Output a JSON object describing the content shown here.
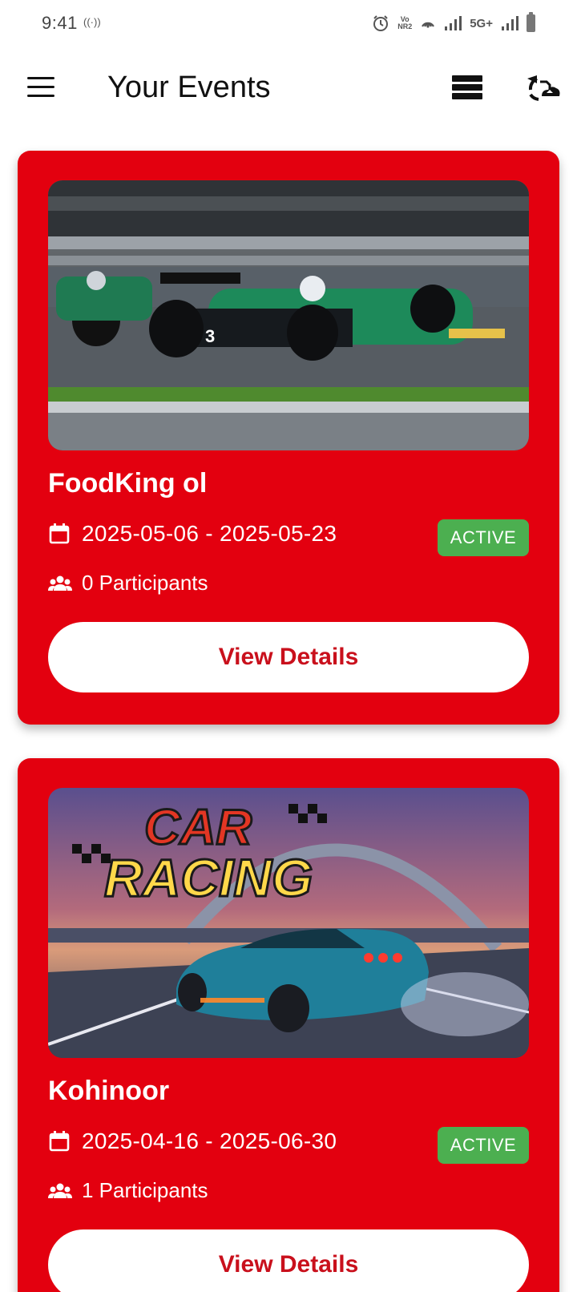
{
  "status_bar": {
    "time": "9:41",
    "hotspot": "((·))",
    "volte_top": "Vo",
    "volte_bottom": "NR2",
    "network": "5G+"
  },
  "app_bar": {
    "title": "Your Events"
  },
  "events": [
    {
      "title": "FoodKing ol",
      "date_range": "2025-05-06 - 2025-05-23",
      "status": "ACTIVE",
      "participants": "0 Participants",
      "button_label": "View Details"
    },
    {
      "title": "Kohinoor",
      "date_range": "2025-04-16 - 2025-06-30",
      "status": "ACTIVE",
      "participants": "1 Participants",
      "button_label": "View Details",
      "banner_text_line1": "CAR",
      "banner_text_line2": "RACING"
    }
  ],
  "colors": {
    "card": "#e3000f",
    "badge": "#4caf50",
    "button_text": "#c9101c"
  }
}
